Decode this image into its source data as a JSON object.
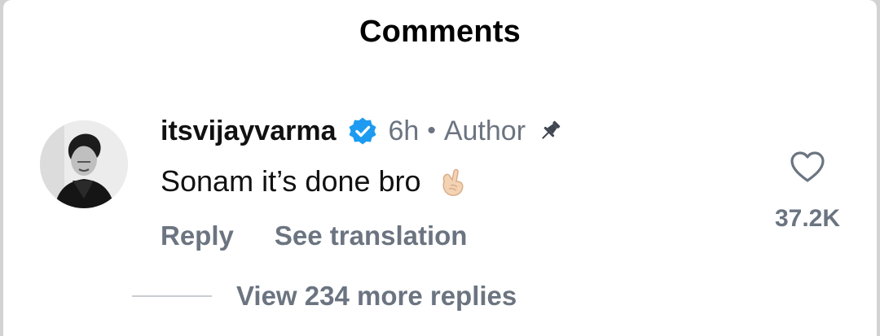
{
  "header": {
    "title": "Comments"
  },
  "comment": {
    "avatar_icon": "user-avatar-photo",
    "username": "itsvijayvarma",
    "verified_icon": "verified-badge-icon",
    "timestamp": "6h",
    "separator": "•",
    "role_tag": "Author",
    "pin_icon": "pin-icon",
    "text": "Sonam it’s done bro",
    "emoji_icon": "finger-heart-emoji",
    "actions": {
      "reply_label": "Reply",
      "translate_label": "See translation"
    },
    "likes": {
      "icon": "heart-outline-icon",
      "count": "37.2K"
    },
    "replies": {
      "label": "View 234 more replies"
    }
  },
  "colors": {
    "background": "#ffffff",
    "primary_text": "#111111",
    "secondary_text": "#6b7480",
    "verified_blue": "#1d9bf0",
    "divider": "#c9cdd2"
  }
}
